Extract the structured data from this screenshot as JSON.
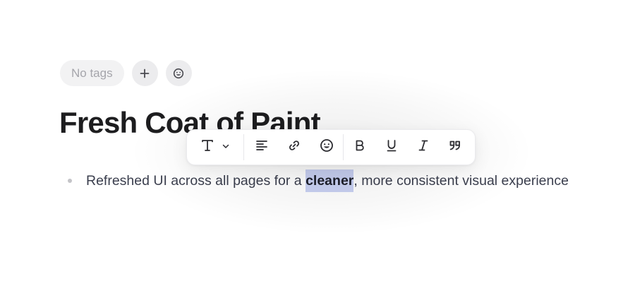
{
  "tags": {
    "empty_label": "No tags",
    "add_icon": "plus-icon",
    "emoji_icon": "smiley-face-icon"
  },
  "document": {
    "title": "Fresh Coat of Paint",
    "bullets": [
      {
        "before": "Refreshed UI across all pages for a ",
        "selected": "cleaner",
        "after": ", more consistent visual experience"
      }
    ]
  },
  "toolbar": {
    "text_style_icon": "text-type-icon",
    "text_style_dropdown_icon": "chevron-down-icon",
    "align_icon": "align-left-icon",
    "link_icon": "link-icon",
    "emoji_icon": "smiley-face-icon",
    "bold_icon": "bold-icon",
    "underline_icon": "underline-icon",
    "italic_icon": "italic-icon",
    "quote_icon": "quote-icon"
  },
  "colors": {
    "selection_highlight": "#c9d1f3",
    "title_text": "#1d1d1f",
    "body_text": "#3b3f4e",
    "tag_pill_bg": "#f2f2f3"
  }
}
